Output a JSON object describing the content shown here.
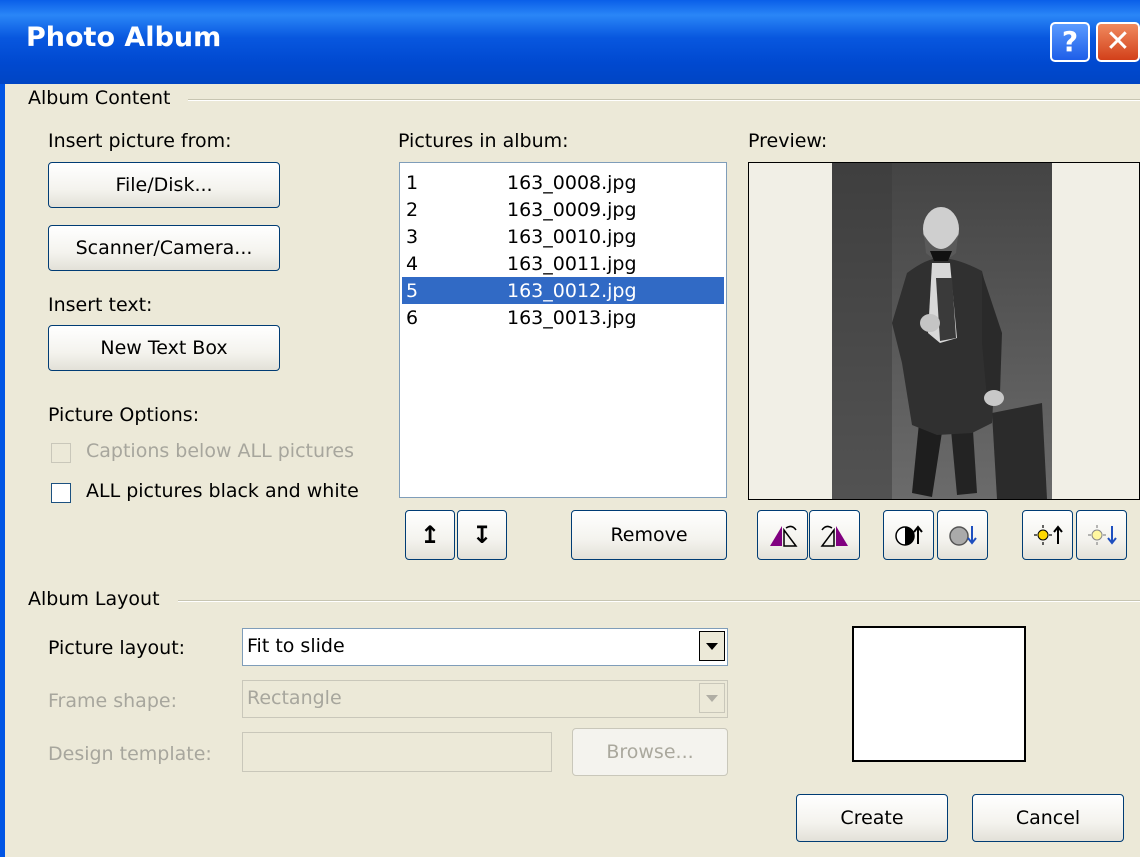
{
  "window": {
    "title": "Photo Album"
  },
  "titlebar": {
    "help_label": "?",
    "close_label": "✕"
  },
  "album_content": {
    "group_label": "Album Content",
    "insert_picture_label": "Insert picture from:",
    "file_disk_button": "File/Disk...",
    "scanner_camera_button": "Scanner/Camera...",
    "insert_text_label": "Insert text:",
    "new_text_box_button": "New Text Box",
    "picture_options_label": "Picture Options:",
    "captions_checkbox": {
      "label": "Captions below ALL pictures",
      "checked": false,
      "enabled": false
    },
    "bw_checkbox": {
      "label": "ALL pictures black and white",
      "checked": false,
      "enabled": true
    }
  },
  "pictures": {
    "label": "Pictures in album:",
    "items": [
      {
        "num": "1",
        "name": "163_0008.jpg"
      },
      {
        "num": "2",
        "name": "163_0009.jpg"
      },
      {
        "num": "3",
        "name": "163_0010.jpg"
      },
      {
        "num": "4",
        "name": "163_0011.jpg"
      },
      {
        "num": "5",
        "name": "163_0012.jpg"
      },
      {
        "num": "6",
        "name": "163_0013.jpg"
      }
    ],
    "selected_index": 4,
    "move_up_glyph": "↥",
    "move_down_glyph": "↧",
    "remove_button": "Remove"
  },
  "preview": {
    "label": "Preview:",
    "tools": [
      "rotate-left-icon",
      "rotate-right-icon",
      "contrast-up-icon",
      "contrast-down-icon",
      "brightness-up-icon",
      "brightness-down-icon"
    ]
  },
  "album_layout": {
    "group_label": "Album Layout",
    "picture_layout_label": "Picture layout:",
    "picture_layout_value": "Fit to slide",
    "frame_shape_label": "Frame shape:",
    "frame_shape_value": "Rectangle",
    "design_template_label": "Design template:",
    "design_template_value": "",
    "browse_button": "Browse..."
  },
  "footer": {
    "create_button": "Create",
    "cancel_button": "Cancel"
  },
  "colors": {
    "titlebar": "#0054e3",
    "selection": "#316ac5",
    "dialog_bg": "#ece9d8"
  }
}
